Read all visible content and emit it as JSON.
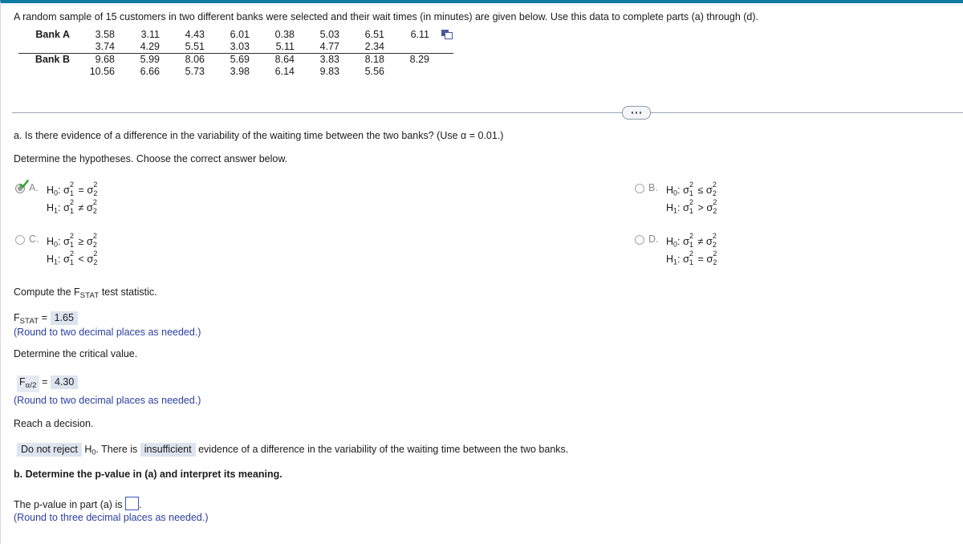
{
  "theme": {
    "top_border_color": "#0e7ba0",
    "highlight_bg": "#dde3ef",
    "blue_text": "#2b3fa0",
    "check_green": "#3aa536",
    "copy_icon_color": "#4a5aa0"
  },
  "problem": {
    "statement": "A random sample of 15 customers in two different banks were selected and their wait times (in minutes) are given below. Use this data to complete parts (a) through (d)."
  },
  "data_table": {
    "rows": [
      {
        "label": "Bank A",
        "values": [
          "3.58",
          "3.11",
          "4.43",
          "6.01",
          "0.38",
          "5.03",
          "6.51",
          "6.11"
        ]
      },
      {
        "label": "",
        "values": [
          "3.74",
          "4.29",
          "5.51",
          "3.03",
          "5.11",
          "4.77",
          "2.34",
          ""
        ]
      },
      {
        "label": "Bank B",
        "values": [
          "9.68",
          "5.99",
          "8.06",
          "5.69",
          "8.64",
          "3.83",
          "8.18",
          "8.29"
        ]
      },
      {
        "label": "",
        "values": [
          "10.56",
          "6.66",
          "5.73",
          "3.98",
          "6.14",
          "9.83",
          "5.56",
          ""
        ]
      }
    ],
    "copy_icon": "copy-to-spreadsheet-icon"
  },
  "divider": {
    "ellipsis_label": "..."
  },
  "part_a": {
    "question": "a. Is there evidence of a difference in the variability of the waiting time between the two banks? (Use α = 0.01.)",
    "instruction": "Determine the hypotheses. Choose the correct answer below.",
    "options": [
      {
        "letter": "A.",
        "selected": true,
        "h0_prefix": "H",
        "h0_sub": "0",
        "h0_rel": "=",
        "h1_prefix": "H",
        "h1_sub": "1",
        "h1_rel": "≠"
      },
      {
        "letter": "B.",
        "selected": false,
        "h0_prefix": "H",
        "h0_sub": "0",
        "h0_rel": "≤",
        "h1_prefix": "H",
        "h1_sub": "1",
        "h1_rel": ">"
      },
      {
        "letter": "C.",
        "selected": false,
        "h0_prefix": "H",
        "h0_sub": "0",
        "h0_rel": "≥",
        "h1_prefix": "H",
        "h1_sub": "1",
        "h1_rel": "<"
      },
      {
        "letter": "D.",
        "selected": false,
        "h0_prefix": "H",
        "h0_sub": "0",
        "h0_rel": "≠",
        "h1_prefix": "H",
        "h1_sub": "1",
        "h1_rel": "="
      }
    ],
    "sigma_glyph": "σ",
    "sigma_sup": "2",
    "sigma_sub_1": "1",
    "sigma_sub_2": "2"
  },
  "fstat": {
    "prompt_pre": "Compute the F",
    "prompt_sub": "STAT",
    "prompt_post": " test statistic.",
    "label_main": "F",
    "label_sub": "STAT",
    "equals": "=",
    "value": "1.65",
    "round_note": "(Round to two decimal places as needed.)"
  },
  "critical": {
    "prompt": "Determine the critical value.",
    "label_main": "F",
    "label_sub": "α/2",
    "equals": "=",
    "value": "4.30",
    "round_note": "(Round to two decimal places as needed.)"
  },
  "decision": {
    "prompt": "Reach a decision.",
    "choice1": "Do not reject",
    "mid1_h": "H",
    "mid1_sub": "0",
    "mid1_text": ". There is",
    "choice2": "insufficient",
    "tail_text": "evidence of a difference in the variability of the waiting time between the two banks."
  },
  "part_b": {
    "question": "b. Determine the p-value in (a) and interpret its meaning.",
    "answer_pre": "The p-value in part (a) is",
    "answer_value": "",
    "answer_post": ".",
    "round_note": "(Round to three decimal places as needed.)"
  }
}
